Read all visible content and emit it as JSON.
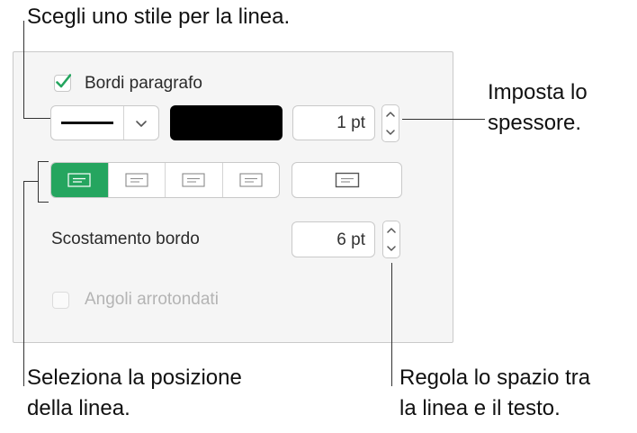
{
  "callouts": {
    "top": "Scegli uno stile per la linea.",
    "right_line1": "Imposta lo",
    "right_line2": "spessore.",
    "bottom_left_line1": "Seleziona la posizione",
    "bottom_left_line2": "della linea.",
    "bottom_right_line1": "Regola lo spazio tra",
    "bottom_right_line2": "la linea e il testo."
  },
  "panel": {
    "paragraph_borders": {
      "label": "Bordi paragrafo",
      "checked": true
    },
    "line_style": {
      "value": "solid"
    },
    "color_well": {
      "color": "#000000"
    },
    "thickness": {
      "value": "1 pt"
    },
    "position_buttons": [
      "top",
      "bottom",
      "top-bottom",
      "left-right"
    ],
    "position_selected": "top",
    "position_all": "box",
    "border_offset": {
      "label": "Scostamento bordo",
      "value": "6 pt"
    },
    "rounded_corners": {
      "label": "Angoli arrotondati",
      "checked": false,
      "enabled": false
    }
  },
  "colors": {
    "accent": "#25a55f",
    "panel_bg": "#f5f5f5",
    "check": "#25a55f"
  }
}
